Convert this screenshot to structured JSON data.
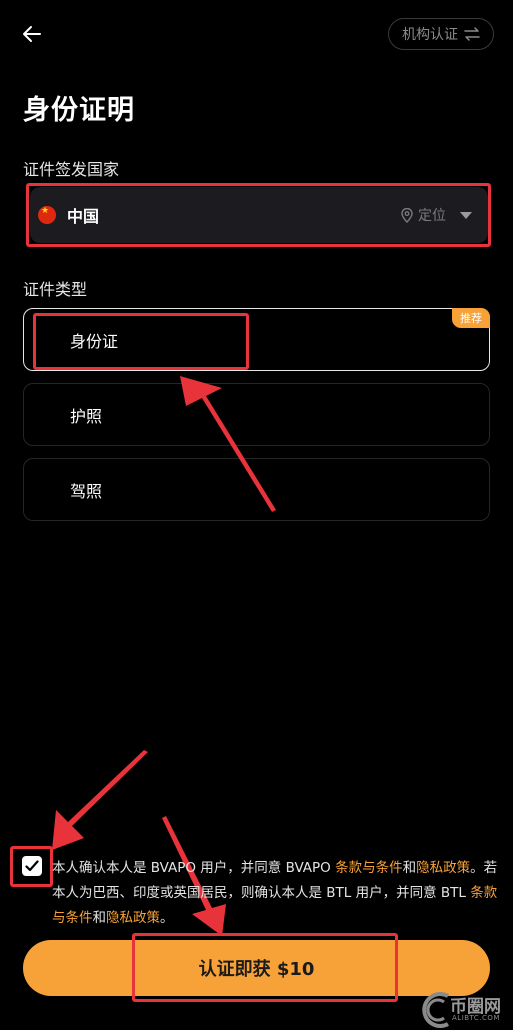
{
  "header": {
    "org_verify_label": "机构认证"
  },
  "page_title": "身份证明",
  "country_section": {
    "label": "证件签发国家",
    "selected_country": "中国",
    "locate_label": "定位"
  },
  "id_type_section": {
    "label": "证件类型",
    "options": [
      {
        "label": "身份证",
        "badge": "推荐",
        "selected": true
      },
      {
        "label": "护照",
        "selected": false
      },
      {
        "label": "驾照",
        "selected": false
      }
    ]
  },
  "terms": {
    "checked": true,
    "part1": "本人确认本人是 BVAPO 用户，并同意 BVAPO ",
    "link1": "条款与条件",
    "part2": "和",
    "link2": "隐私政策",
    "part3": "。若本人为巴西、印度或英国居民，则确认本人是 BTL 用户，并同意 BTL ",
    "link3": "条款与条件",
    "part4": "和",
    "link4": "隐私政策",
    "part5": "。"
  },
  "cta": {
    "label": "认证即获 $10"
  },
  "watermark": {
    "text": "币圈网",
    "sub": "ALIBTC.COM"
  },
  "colors": {
    "accent": "#f7a238",
    "annotation": "#e8333b",
    "background": "#000000"
  }
}
